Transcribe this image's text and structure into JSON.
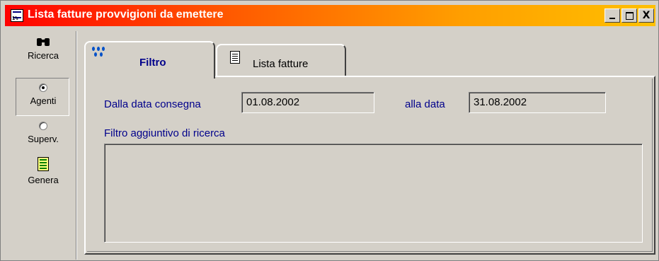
{
  "window": {
    "title": "Lista fatture provvigioni da emettere",
    "app_icon_text": "1%",
    "controls": [
      "minimize",
      "maximize",
      "close"
    ],
    "close_label": "X"
  },
  "sidebar": {
    "items": [
      {
        "label": "Ricerca",
        "icon": "binoculars-icon"
      },
      {
        "label": "Agenti",
        "icon": "radio",
        "checked": true
      },
      {
        "label": "Superv.",
        "icon": "radio",
        "checked": false
      },
      {
        "label": "Genera",
        "icon": "generate-icon"
      }
    ]
  },
  "tabs": [
    {
      "label": "Filtro",
      "active": true,
      "icon": "filter-icon"
    },
    {
      "label": "Lista fatture",
      "active": false,
      "icon": "document-icon"
    }
  ],
  "filter": {
    "date_from_label": "Dalla data consegna",
    "date_from_value": "01.08.2002",
    "date_to_label": "alla data",
    "date_to_value": "31.08.2002",
    "extra_filter_label": "Filtro aggiuntivo di ricerca",
    "extra_filter_value": ""
  },
  "colors": {
    "title_gradient_start": "#ff0000",
    "title_gradient_end": "#ffc000",
    "label_color": "#00008b",
    "face": "#d4d0c8"
  }
}
